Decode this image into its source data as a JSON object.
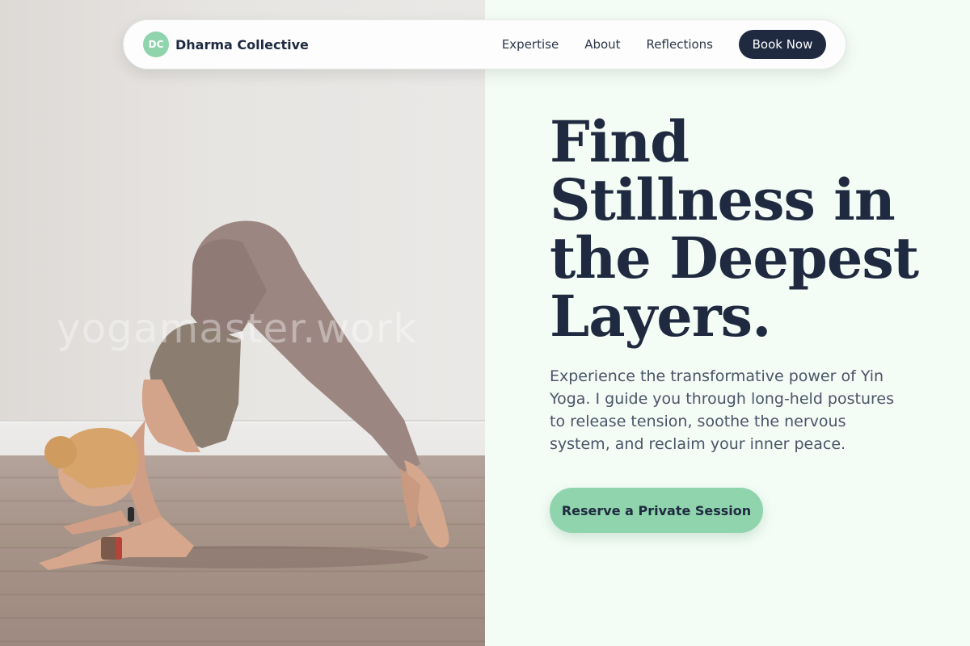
{
  "nav": {
    "brand_mark": "DC",
    "brand_name": "Dharma Collective",
    "links": [
      {
        "label": "Expertise"
      },
      {
        "label": "About"
      },
      {
        "label": "Reflections"
      }
    ],
    "book_label": "Book Now"
  },
  "photo": {
    "watermark": "yogamaster.work"
  },
  "hero": {
    "headline": "Find Stillness in the Deepest Layers.",
    "lede": "Experience the transformative power of Yin Yoga. I guide you through long-held postures to release tension, soothe the nervous system, and reclaim your inner peace.",
    "cta_label": "Reserve a Private Session"
  },
  "colors": {
    "accent": "#8fd4ad",
    "navy": "#1f2a40",
    "background": "#f3fcf5"
  }
}
